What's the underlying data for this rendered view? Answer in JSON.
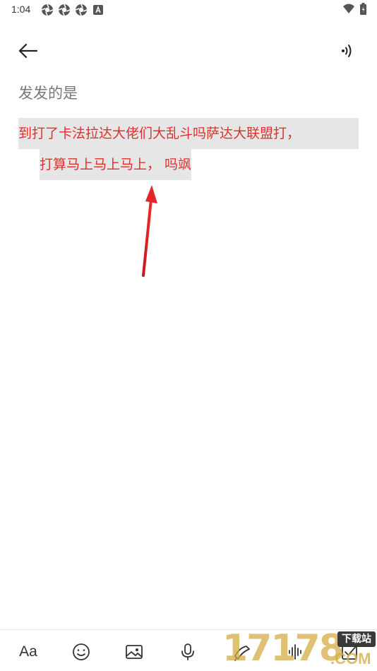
{
  "status_bar": {
    "time": "1:04",
    "left_icons": [
      "aperture-icon",
      "aperture-icon",
      "aperture-icon",
      "a-badge-icon"
    ],
    "right_icons": [
      "wifi-icon",
      "battery-icon"
    ]
  },
  "top_bar": {
    "back_icon": "arrow-left-icon",
    "speak_icon": "read-aloud-icon"
  },
  "note": {
    "title": "发发的是",
    "body_line1": "到打了卡法拉达大佬们大乱斗吗萨达大联盟打，",
    "body_line2": "打算马上马上马上， 吗飒",
    "text_color": "#e0302c",
    "highlight_color": "#e6e6e6"
  },
  "annotation": {
    "arrow_color": "#e0302c"
  },
  "toolbar": {
    "text_format_label": "Aa",
    "items": [
      "text-format-button",
      "emoji-icon",
      "image-icon",
      "mic-icon",
      "handwriting-icon",
      "audio-wave-icon",
      "checkbox-icon"
    ]
  },
  "watermark": {
    "main": "17178",
    "badge": "下载站",
    "suffix": ".COM"
  }
}
